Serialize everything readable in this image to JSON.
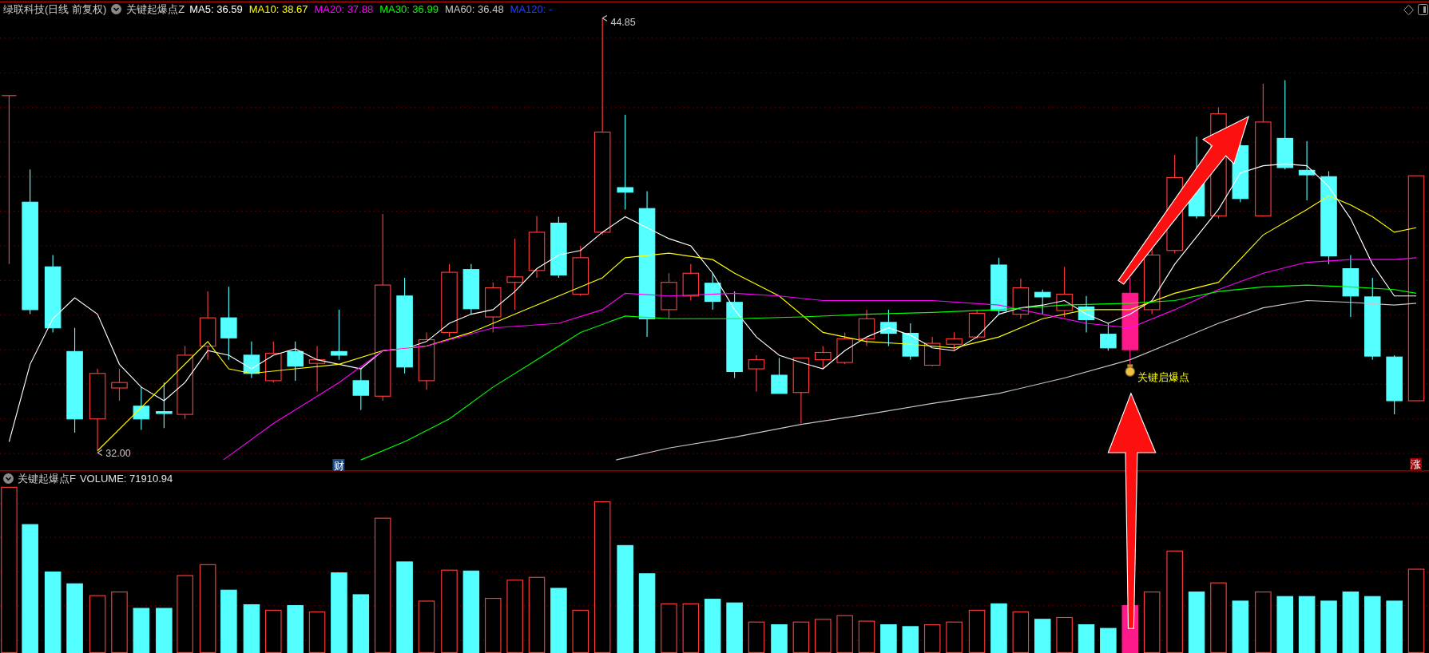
{
  "header": {
    "title": "绿联科技(日线 前复权)",
    "indicator": "关键起爆点Z",
    "ma": [
      {
        "label": "MA5: 36.59",
        "color": "#ffffff"
      },
      {
        "label": "MA10: 38.67",
        "color": "#ffff00"
      },
      {
        "label": "MA20: 37.88",
        "color": "#ff00ff"
      },
      {
        "label": "MA30: 36.99",
        "color": "#00ff00"
      },
      {
        "label": "MA60: 36.48",
        "color": "#c8c8c8"
      },
      {
        "label": "MA120: -",
        "color": "#2040ff"
      }
    ]
  },
  "chart": {
    "high_label": "44.85",
    "low_label": "32.00",
    "signal_label": "关键启爆点",
    "badges": [
      {
        "text": "财",
        "kind": "finance"
      },
      {
        "text": "涨",
        "kind": "limit"
      }
    ]
  },
  "volume_panel": {
    "indicator": "关键起爆点F",
    "reading": "VOLUME: 71910.94"
  }
}
